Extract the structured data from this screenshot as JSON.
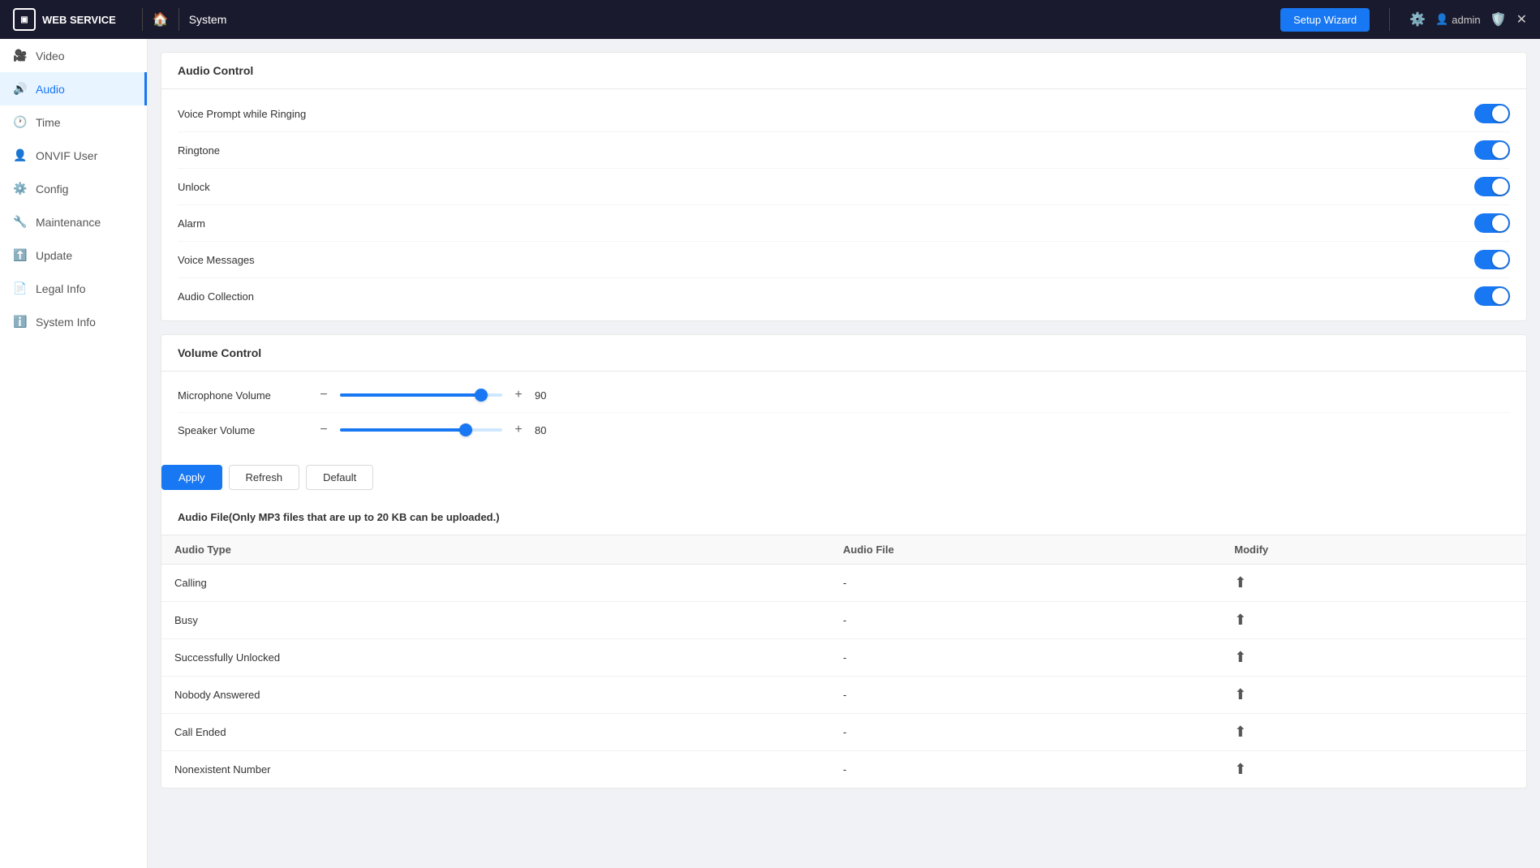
{
  "app": {
    "name": "WEB SERVICE",
    "breadcrumb": "System",
    "setup_wizard_label": "Setup Wizard",
    "admin_label": "admin"
  },
  "sidebar": {
    "items": [
      {
        "id": "video",
        "label": "Video",
        "icon": "🎥"
      },
      {
        "id": "audio",
        "label": "Audio",
        "icon": "🔊",
        "active": true
      },
      {
        "id": "time",
        "label": "Time",
        "icon": "🕐"
      },
      {
        "id": "onvif-user",
        "label": "ONVIF User",
        "icon": "👤"
      },
      {
        "id": "config",
        "label": "Config",
        "icon": "⚙️"
      },
      {
        "id": "maintenance",
        "label": "Maintenance",
        "icon": "🔧"
      },
      {
        "id": "update",
        "label": "Update",
        "icon": "⬆️"
      },
      {
        "id": "legal-info",
        "label": "Legal Info",
        "icon": "📄"
      },
      {
        "id": "system-info",
        "label": "System Info",
        "icon": "ℹ️"
      }
    ]
  },
  "audio_control": {
    "section_title": "Audio Control",
    "toggles": [
      {
        "id": "voice-prompt",
        "label": "Voice Prompt while Ringing",
        "on": true
      },
      {
        "id": "ringtone",
        "label": "Ringtone",
        "on": true
      },
      {
        "id": "unlock",
        "label": "Unlock",
        "on": true
      },
      {
        "id": "alarm",
        "label": "Alarm",
        "on": true
      },
      {
        "id": "voice-messages",
        "label": "Voice Messages",
        "on": true
      },
      {
        "id": "audio-collection",
        "label": "Audio Collection",
        "on": true
      }
    ]
  },
  "volume_control": {
    "section_title": "Volume Control",
    "items": [
      {
        "id": "microphone",
        "label": "Microphone Volume",
        "value": 90,
        "pct": 90
      },
      {
        "id": "speaker",
        "label": "Speaker Volume",
        "value": 80,
        "pct": 80
      }
    ]
  },
  "buttons": {
    "apply": "Apply",
    "refresh": "Refresh",
    "default": "Default"
  },
  "audio_file": {
    "note": "Audio File(Only MP3 files that are up to 20 KB can be uploaded.)",
    "columns": [
      "Audio Type",
      "Audio File",
      "Modify"
    ],
    "rows": [
      {
        "type": "Calling",
        "file": "-"
      },
      {
        "type": "Busy",
        "file": "-"
      },
      {
        "type": "Successfully Unlocked",
        "file": "-"
      },
      {
        "type": "Nobody Answered",
        "file": "-"
      },
      {
        "type": "Call Ended",
        "file": "-"
      },
      {
        "type": "Nonexistent Number",
        "file": "-"
      }
    ]
  }
}
